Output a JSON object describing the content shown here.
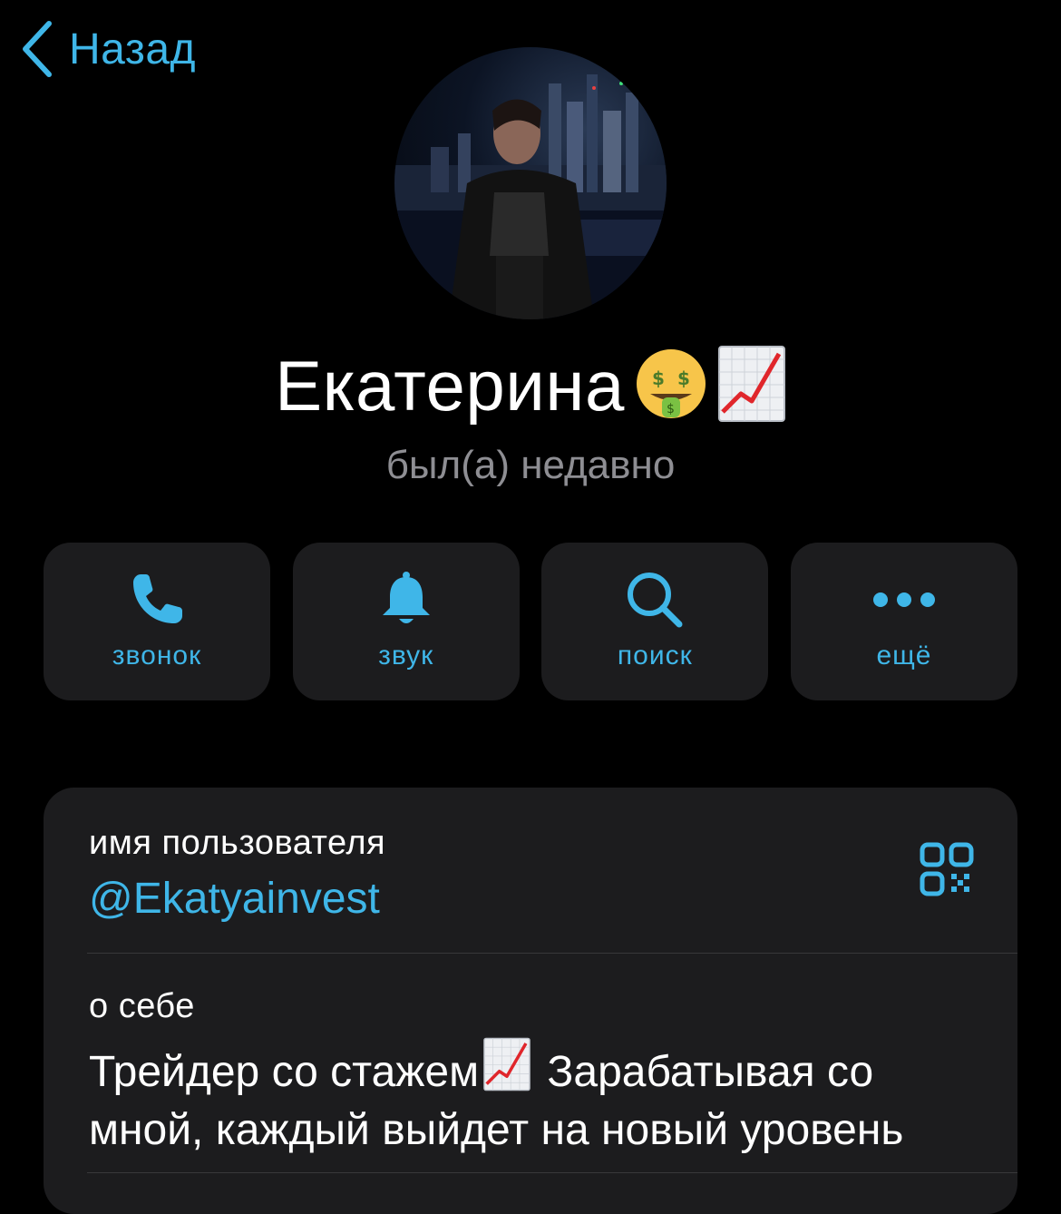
{
  "nav": {
    "back_label": "Назад",
    "back_icon": "chevron-left-icon"
  },
  "profile": {
    "name": "Екатерина",
    "name_emojis": [
      "money-mouth-face-emoji",
      "chart-increasing-emoji"
    ],
    "status": "был(а) недавно"
  },
  "actions": [
    {
      "label": "звонок",
      "icon": "phone-icon"
    },
    {
      "label": "звук",
      "icon": "bell-icon"
    },
    {
      "label": "поиск",
      "icon": "search-icon"
    },
    {
      "label": "ещё",
      "icon": "more-dots-icon"
    }
  ],
  "info": {
    "username_label": "имя пользователя",
    "username": "@Ekatyainvest",
    "qr_icon": "qr-code-icon",
    "about_label": "о себе",
    "about_part1": "Трейдер со стажем",
    "about_part2": " Зарабатывая со мной, каждый выйдет на новый уровень"
  },
  "colors": {
    "accent": "#3fb6e8",
    "background": "#000000",
    "card": "#1c1c1e",
    "secondary_text": "#8e8e93"
  }
}
